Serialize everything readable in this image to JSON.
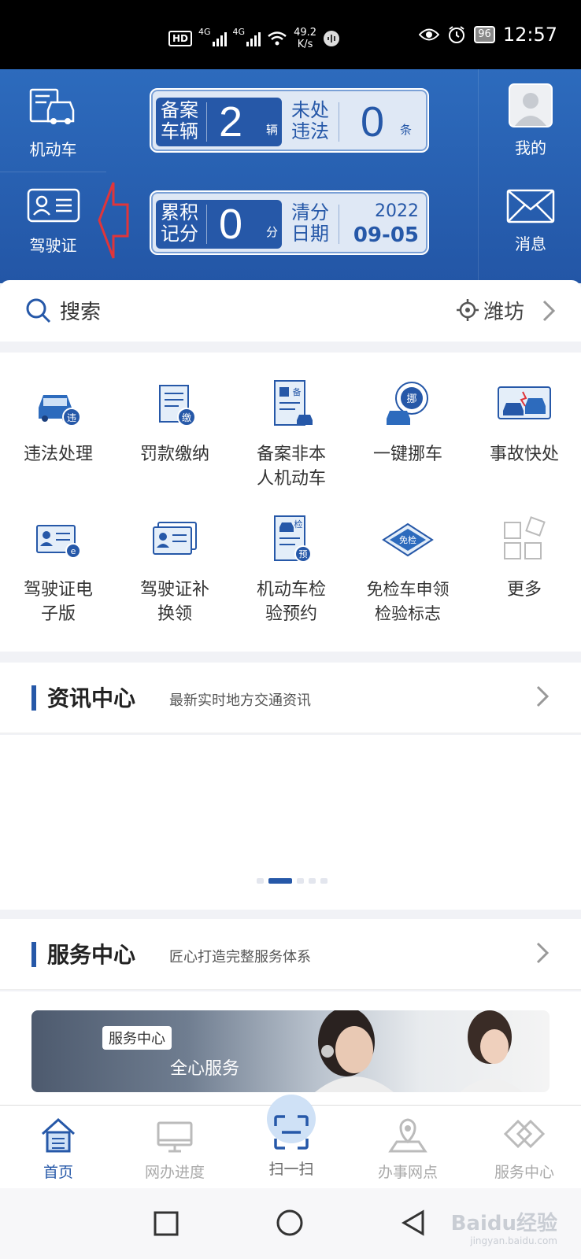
{
  "status_bar": {
    "network_speed_value": "49.2",
    "network_speed_unit": "K/s",
    "battery": "96",
    "time": "12:57",
    "hd": "HD",
    "net1": "4G",
    "net2": "4G"
  },
  "header": {
    "vehicle_label": "机动车",
    "license_label": "驾驶证",
    "mine_label": "我的",
    "message_label": "消息",
    "card1": {
      "left_label": "备案\n车辆",
      "left_value": "2",
      "left_unit": "辆",
      "right_label": "未处\n违法",
      "right_value": "0",
      "right_unit": "条"
    },
    "card2": {
      "left_label": "累积\n记分",
      "left_value": "0",
      "left_unit": "分",
      "right_label": "清分\n日期",
      "right_year": "2022",
      "right_date": "09-05"
    }
  },
  "search": {
    "placeholder": "搜索",
    "location": "潍坊"
  },
  "services": [
    {
      "label": "违法处理",
      "icon": "car-violation-icon"
    },
    {
      "label": "罚款缴纳",
      "icon": "fine-payment-icon"
    },
    {
      "label": "备案非本\n人机动车",
      "icon": "register-vehicle-icon"
    },
    {
      "label": "一键挪车",
      "icon": "move-car-icon"
    },
    {
      "label": "事故快处",
      "icon": "accident-icon"
    },
    {
      "label": "驾驶证电\n子版",
      "icon": "e-license-icon"
    },
    {
      "label": "驾驶证补\n换领",
      "icon": "license-renew-icon"
    },
    {
      "label": "机动车检\n验预约",
      "icon": "inspection-booking-icon"
    },
    {
      "label": "免检车申领\n检验标志",
      "icon": "exempt-inspection-icon"
    },
    {
      "label": "更多",
      "icon": "more-grid-icon"
    }
  ],
  "service_badges": {
    "violation": "违",
    "fine": "缴",
    "register": "备",
    "move": "挪",
    "inspect": "检",
    "booking": "预",
    "exempt": "免检"
  },
  "news": {
    "title": "资讯中心",
    "subtitle": "最新实时地方交通资讯",
    "carousel_count": 5,
    "carousel_active": 1
  },
  "service_center": {
    "title": "服务中心",
    "subtitle": "匠心打造完整服务体系",
    "banner_tag": "服务中心",
    "banner_text": "全心服务"
  },
  "bottom_nav": [
    {
      "label": "首页",
      "active": true
    },
    {
      "label": "网办进度",
      "active": false
    },
    {
      "label": "扫一扫",
      "active": false
    },
    {
      "label": "办事网点",
      "active": false
    },
    {
      "label": "服务中心",
      "active": false
    }
  ],
  "watermark": {
    "text": "Baidu经验",
    "sub": "jingyan.baidu.com"
  },
  "colors": {
    "brand_blue": "#2658a8",
    "header_blue": "#2d6bbd",
    "arrow_red": "#e0353a"
  }
}
